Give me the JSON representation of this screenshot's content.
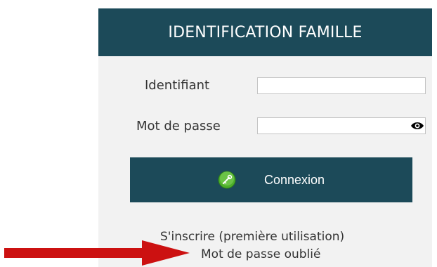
{
  "header": {
    "title": "IDENTIFICATION FAMILLE"
  },
  "form": {
    "identifiant_label": "Identifiant",
    "identifiant_value": "",
    "password_label": "Mot de passe",
    "password_value": "",
    "show_password_icon": "eye-icon"
  },
  "login_button": {
    "label": "Connexion",
    "icon": "key-icon"
  },
  "links": {
    "register": "S'inscrire (première utilisation)",
    "forgot_password": "Mot de passe oublié"
  },
  "annotation": {
    "arrow_icon": "red-arrow-icon"
  },
  "colors": {
    "header_bg": "#1c4a59",
    "panel_bg": "#f2f2f2",
    "arrow": "#cc1111",
    "button_icon": "#4caf2a"
  }
}
